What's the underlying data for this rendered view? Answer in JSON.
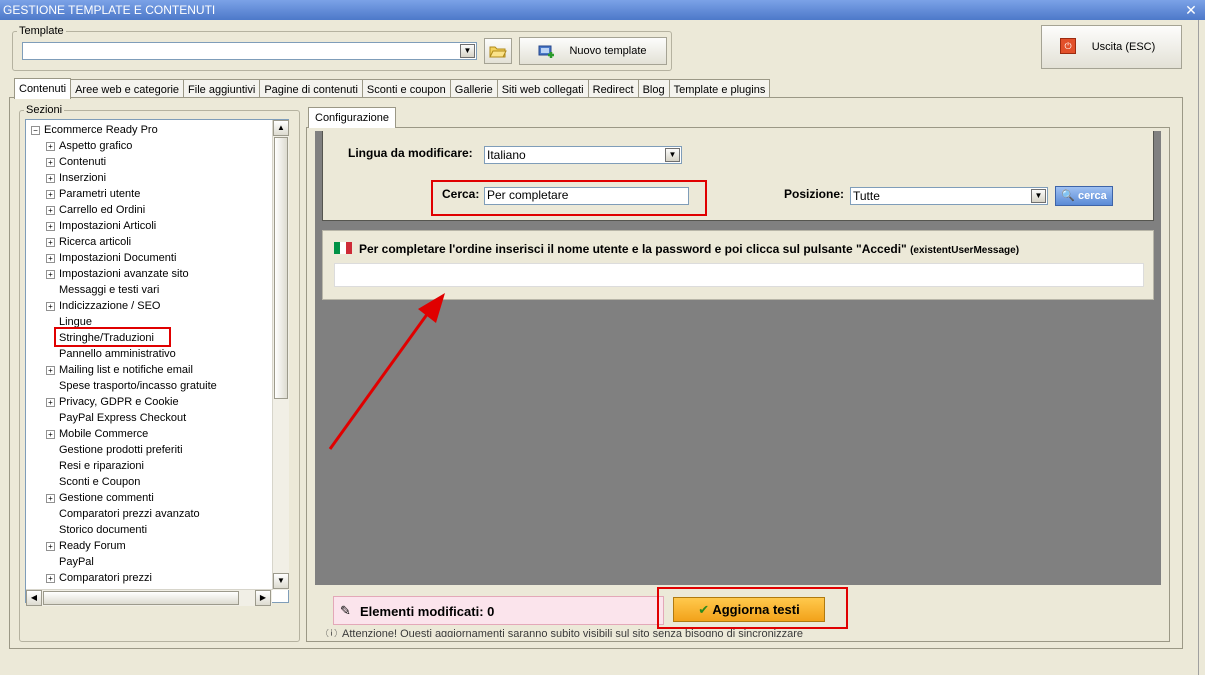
{
  "window": {
    "title": "GESTIONE TEMPLATE E CONTENUTI",
    "close_label": "x"
  },
  "template_group": {
    "legend": "Template",
    "select_value": "",
    "new_template_label": "Nuovo template"
  },
  "exit_button": {
    "label": "Uscita (ESC)"
  },
  "tabs": [
    {
      "label": "Contenuti"
    },
    {
      "label": "Aree web e categorie"
    },
    {
      "label": "File aggiuntivi"
    },
    {
      "label": "Pagine di contenuti"
    },
    {
      "label": "Sconti e coupon"
    },
    {
      "label": "Gallerie"
    },
    {
      "label": "Siti web collegati"
    },
    {
      "label": "Redirect"
    },
    {
      "label": "Blog"
    },
    {
      "label": "Template e plugins"
    }
  ],
  "sections": {
    "legend": "Sezioni",
    "root": "Ecommerce Ready Pro",
    "items": [
      {
        "label": "Aspetto grafico",
        "expandable": true
      },
      {
        "label": "Contenuti",
        "expandable": true
      },
      {
        "label": "Inserzioni",
        "expandable": true
      },
      {
        "label": "Parametri utente",
        "expandable": true
      },
      {
        "label": "Carrello ed Ordini",
        "expandable": true
      },
      {
        "label": "Impostazioni Articoli",
        "expandable": true
      },
      {
        "label": "Ricerca articoli",
        "expandable": true
      },
      {
        "label": "Impostazioni Documenti",
        "expandable": true
      },
      {
        "label": "Impostazioni avanzate sito",
        "expandable": true
      },
      {
        "label": "Messaggi e testi vari",
        "expandable": false
      },
      {
        "label": "Indicizzazione / SEO",
        "expandable": true
      },
      {
        "label": "Lingue",
        "expandable": false
      },
      {
        "label": "Stringhe/Traduzioni",
        "expandable": false
      },
      {
        "label": "Pannello amministrativo",
        "expandable": false
      },
      {
        "label": "Mailing list e notifiche email",
        "expandable": true
      },
      {
        "label": "Spese trasporto/incasso gratuite",
        "expandable": false
      },
      {
        "label": "Privacy, GDPR e Cookie",
        "expandable": true
      },
      {
        "label": "PayPal Express Checkout",
        "expandable": false
      },
      {
        "label": "Mobile Commerce",
        "expandable": true
      },
      {
        "label": "Gestione prodotti preferiti",
        "expandable": false
      },
      {
        "label": "Resi e riparazioni",
        "expandable": false
      },
      {
        "label": "Sconti e Coupon",
        "expandable": false
      },
      {
        "label": "Gestione commenti",
        "expandable": true
      },
      {
        "label": "Comparatori prezzi avanzato",
        "expandable": false
      },
      {
        "label": "Storico documenti",
        "expandable": false
      },
      {
        "label": "Ready Forum",
        "expandable": true
      },
      {
        "label": "PayPal",
        "expandable": false
      },
      {
        "label": "Comparatori prezzi",
        "expandable": true
      }
    ]
  },
  "config": {
    "tab_label": "Configurazione",
    "language_label": "Lingua da modificare:",
    "language_value": "Italiano",
    "search_label": "Cerca:",
    "search_value": "Per completare",
    "position_label": "Posizione:",
    "position_value": "Tutte",
    "search_button": "cerca"
  },
  "result": {
    "message": "Per completare l'ordine inserisci il nome utente e la password e poi clicca sul pulsante \"Accedi\"",
    "key": "(existentUserMessage)",
    "value": ""
  },
  "footer": {
    "modified_label": "Elementi modificati: 0",
    "update_button": "Aggiorna testi",
    "warning": "Attenzione! Questi aggiornamenti saranno subito visibili sul sito senza bisogno di sincronizzare"
  },
  "colors": {
    "highlight": "#e00000",
    "update_button": "#f5b533",
    "flag_green": "#009246",
    "flag_white": "#ffffff",
    "flag_red": "#ce2b37"
  }
}
